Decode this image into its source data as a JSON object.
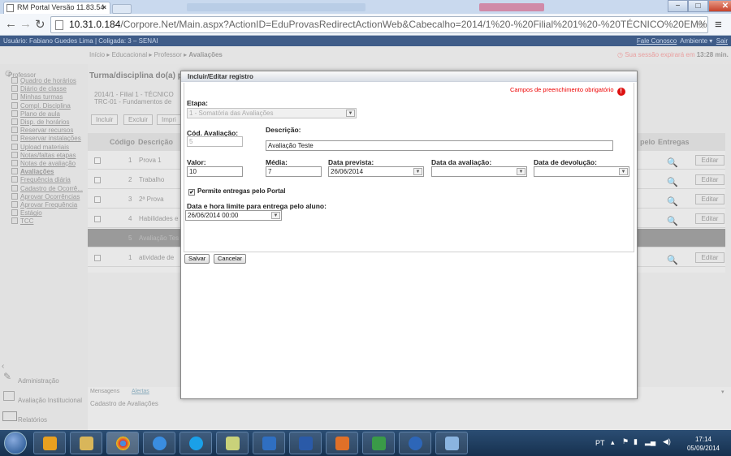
{
  "browser": {
    "tab_title": "RM Portal Versão 11.83.54",
    "tab_close": "×",
    "url_host": "10.31.0.184",
    "url_rest": "/Corpore.Net/Main.aspx?ActionID=EduProvasRedirectActionWeb&Cabecalho=2014/1%20-%20Filial%201%20-%20TÉCNICO%20EM%20REDE%2C",
    "win_minimize": "−",
    "win_maximize": "□",
    "win_close": "✕"
  },
  "header": {
    "user": "Usuário: Fabiano Guedes Lima",
    "coligada": "Coligada: 3 – SENAI",
    "links": [
      "Fale Conosco",
      "Ambiente ▾",
      "Sair"
    ]
  },
  "breadcrumb": {
    "items": [
      "Início",
      "Educacional",
      "Professor"
    ],
    "current": "Avaliações",
    "session_msg": "Sua sessão expirará em",
    "session_time": "13:28 min."
  },
  "sidebar": {
    "section": "Professor",
    "items": [
      "Quadro de horários",
      "Diário de classe",
      "Minhas turmas",
      "Compl. Disciplina",
      "Plano de aula",
      "Disp. de horários",
      "Reservar recursos",
      "Reservar instalações",
      "Upload materiais",
      "Notas/faltas etapas",
      "Notas de avaliação",
      "Avaliações",
      "Frequência diária",
      "Cadastro de Ocorrê...",
      "Aprovar Ocorrências",
      "Aprovar Frequência",
      "Estágio",
      "TCC"
    ],
    "bottom": [
      "Administração",
      "Avaliação Institucional",
      "Relatórios"
    ]
  },
  "page": {
    "turma_title": "Turma/disciplina do(a) p",
    "turma_line1": "2014/1 - Filial 1 - TÉCNICO",
    "turma_line2": "TRC-01 - Fundamentos de",
    "buttons": [
      "Incluir",
      "Excluir",
      "Impri"
    ],
    "columns": [
      "Código",
      "Descrição",
      "pelo",
      "Entregas"
    ],
    "rows": [
      {
        "codigo": "1",
        "descricao": "Prova 1"
      },
      {
        "codigo": "2",
        "descricao": "Trabalho"
      },
      {
        "codigo": "3",
        "descricao": "2ª Prova"
      },
      {
        "codigo": "4",
        "descricao": "Habilidades e"
      },
      {
        "codigo": "5",
        "descricao": "Avaliação Tes"
      },
      {
        "codigo": "1",
        "descricao": "atividade de"
      }
    ],
    "edit_label": "Editar",
    "msg_tabs": [
      "Mensagens",
      "Alertas"
    ],
    "msg_text": "Cadastro de Avaliações"
  },
  "modal": {
    "title": "Incluir/Editar registro",
    "required_note": "Campos de preenchimento obrigatório",
    "required_mark": "!",
    "etapa_label": "Etapa:",
    "etapa_value": "1 - Somatória das Avaliações",
    "cod_label": "Cód. Avaliação:",
    "cod_value": "5",
    "descricao_label": "Descrição:",
    "descricao_value": "Avaliação Teste",
    "valor_label": "Valor:",
    "valor_value": "10",
    "media_label": "Média:",
    "media_value": "7",
    "data_prevista_label": "Data prevista:",
    "data_prevista_value": "26/06/2014",
    "data_avaliacao_label": "Data da avaliação:",
    "data_avaliacao_value": "",
    "data_devolucao_label": "Data de devolução:",
    "data_devolucao_value": "",
    "permite_label": "Permite entregas pelo Portal",
    "permite_checked": "✔",
    "limite_label": "Data e hora limite para entrega pelo aluno:",
    "limite_value": "26/06/2014 00:00",
    "save": "Salvar",
    "cancel": "Cancelar"
  },
  "taskbar": {
    "lang": "PT",
    "time": "17:14",
    "date": "05/09/2014"
  }
}
